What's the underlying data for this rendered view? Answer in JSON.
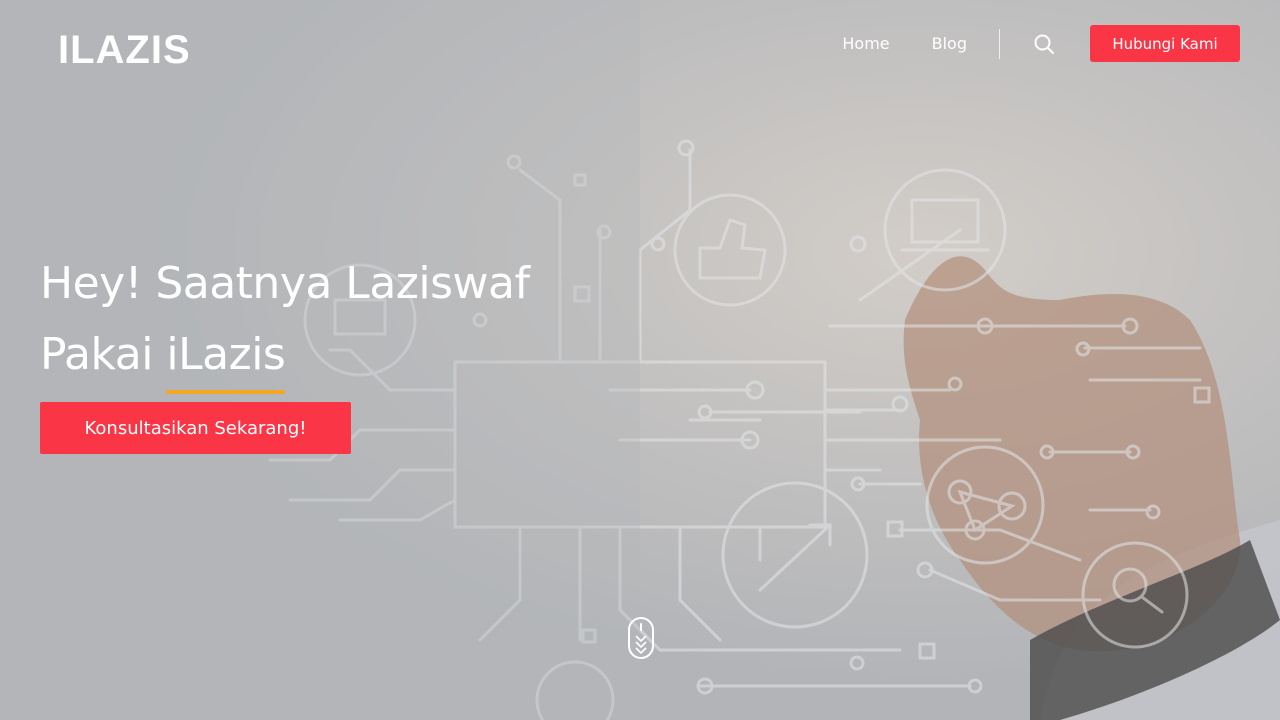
{
  "header": {
    "logo_text": "ILAZIS",
    "nav": [
      {
        "label": "Home"
      },
      {
        "label": "Blog"
      }
    ],
    "search_icon": "search-icon",
    "contact_label": "Hubungi Kami"
  },
  "hero": {
    "headline_line1": "Hey! Saatnya Laziswaf",
    "headline_line2_prefix": "Pakai ",
    "headline_brand": "iLazis",
    "cta_label": "Konsultasikan Sekarang!",
    "scroll_icon": "mouse-scroll-icon"
  },
  "colors": {
    "accent": "#f93546",
    "underline": "#f5a623",
    "background": "#b4b6ba",
    "text": "#ffffff"
  }
}
